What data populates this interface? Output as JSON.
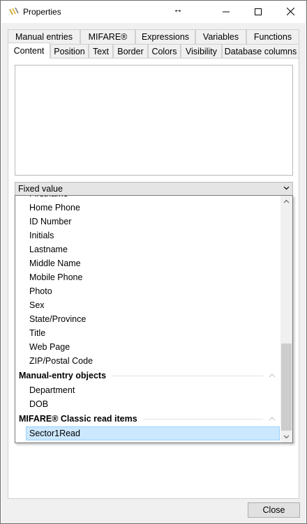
{
  "window": {
    "title": "Properties",
    "icon": "app-logo-icon",
    "controls": [
      "minimize-icon",
      "maximize-icon",
      "close-icon"
    ]
  },
  "tabs": {
    "row1": [
      "Manual entries",
      "MIFARE®",
      "Expressions",
      "Variables",
      "Functions"
    ],
    "row2": [
      "Content",
      "Position",
      "Text",
      "Border",
      "Colors",
      "Visibility",
      "Database columns"
    ],
    "active": "Content"
  },
  "content": {
    "source_select": "Fixed value"
  },
  "dropdown": {
    "partial_top_item": "Firstname",
    "items": [
      "Home Phone",
      "ID Number",
      "Initials",
      "Lastname",
      "Middle Name",
      "Mobile Phone",
      "Photo",
      "Sex",
      "State/Province",
      "Title",
      "Web Page",
      "ZIP/Postal Code"
    ],
    "groups": [
      {
        "header": "Manual-entry objects",
        "items": [
          "Department",
          "DOB"
        ]
      },
      {
        "header": "MIFARE® Classic read items",
        "items": [
          "Sector1Read"
        ]
      }
    ],
    "selected": "Sector1Read"
  },
  "footer": {
    "close_label": "Close"
  },
  "colors": {
    "selection": "#cce8ff",
    "selection_border": "#99d1ff",
    "chrome": "#f0f0f0"
  }
}
